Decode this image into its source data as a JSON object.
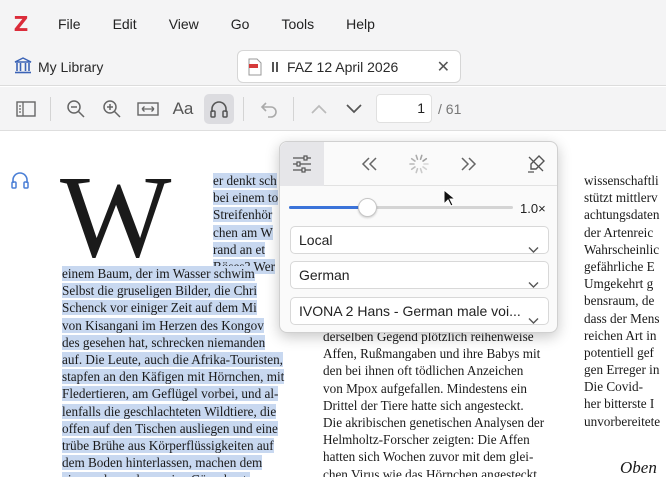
{
  "menu": {
    "logo": "Z",
    "items": [
      "File",
      "Edit",
      "View",
      "Go",
      "Tools",
      "Help"
    ]
  },
  "tabs": {
    "library_label": "My Library",
    "document_title": "FAZ 12 April 2026"
  },
  "toolbar": {
    "page_current": "1",
    "page_total": "/ 61",
    "font_button": "Aa"
  },
  "read_aloud": {
    "speed": "1.0×",
    "speed_value": 1.0,
    "speed_fraction": 0.35,
    "source": "Local",
    "language": "German",
    "voice": "IVONA 2 Hans - German male voi..."
  },
  "document": {
    "drop_cap": "W",
    "col1_top": [
      "er denkt sch",
      "bei einem to",
      "Streifenhör",
      "chen am W",
      "rand an et",
      "Böses? Wer"
    ],
    "col1_full": [
      "einem Baum, der im Wasser schwim",
      "Selbst die gruseligen Bilder, die Chri",
      "Schenck vor einiger Zeit auf dem Mi",
      "von Kisangani im Herzen des Kongov",
      "des gesehen hat, schrecken niemanden",
      "auf. Die Leute, auch die Afrika-Touristen,",
      "stapfen an den Käfigen mit Hörnchen, mit",
      "Fledertieren, am Geflügel vorbei, und al-",
      "lenfalls die geschlachteten Wildtiere, die",
      "offen auf den Tischen ausliegen und eine",
      "trübe Brühe aus Körperflüssigkeiten auf",
      "dem Boden hinterlassen, machen dem",
      "einen oder anderen eine Gänsehaut."
    ],
    "col2": [
      "derselben Gegend plötzlich reihenweise",
      "Affen, Rußmangaben und ihre Babys mit",
      "den bei ihnen oft tödlichen Anzeichen",
      "von Mpox aufgefallen. Mindestens ein",
      "Drittel der Tiere hatte sich angesteckt.",
      "Die akribischen genetischen Analysen der",
      "Helmholtz-Forscher zeigten: Die Affen",
      "hatten sich Wochen zuvor mit dem glei-",
      "chen Virus wie das Hörnchen angesteckt."
    ],
    "col3": [
      "wissenschaftli",
      "stützt mittlerv",
      "achtungsdaten",
      "der Artenreic",
      "Wahrscheinlic",
      "gefährliche E",
      "Umgekehrt g",
      "bensraum, de",
      "dass der Mens",
      "reichen Art in",
      "potentiell gef",
      "gen Erreger in",
      "   Die Covid-",
      "her bitterste I",
      "unvorbereitete"
    ],
    "col3_tail": "Oben"
  }
}
